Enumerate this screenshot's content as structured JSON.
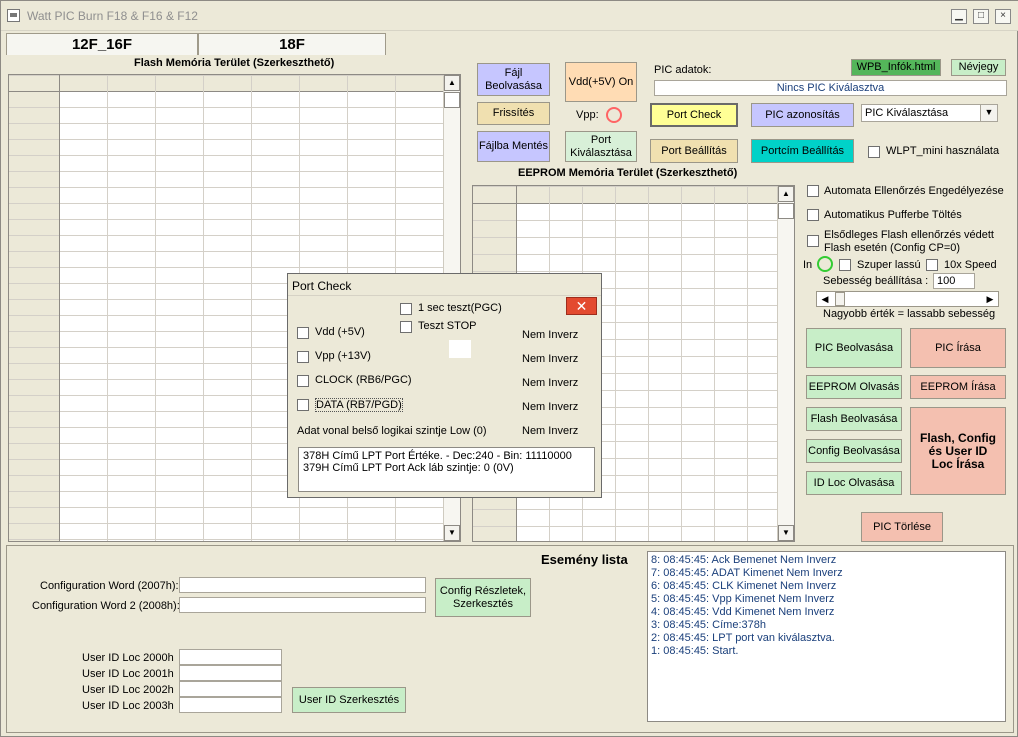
{
  "window": {
    "title": "Watt PIC Burn F18 & F16 & F12",
    "min_label": "▁",
    "max_label": "□",
    "close_label": "×"
  },
  "tabs": [
    "12F_16F",
    "18F"
  ],
  "flash": {
    "title": "Flash Memória Terület (Szerkeszthető)"
  },
  "eeprom": {
    "title": "EEPROM Memória Terület (Szerkeszthető)"
  },
  "buttons": {
    "file_read": "Fájl Beolvasása",
    "vdd_on": "Vdd(+5V) On",
    "refresh": "Frissítés",
    "file_save": "Fájlba Mentés",
    "port_select": "Port Kiválasztása",
    "port_check": "Port Check",
    "pic_identify": "PIC azonosítás",
    "port_settings": "Port Beállítás",
    "port_address_settings": "Portcím Beállítás",
    "wpb_info": "WPB_Infók.html",
    "business_card": "Névjegy",
    "pic_read": "PIC Beolvasása",
    "pic_write": "PIC  Írása",
    "eeprom_read": "EEPROM Olvasás",
    "eeprom_write": "EEPROM Írása",
    "flash_read": "Flash Beolvasása",
    "config_read": "Config Beolvasása",
    "idloc_read": "ID Loc Olvasása",
    "flash_config_write": "Flash, Config és User ID Loc Írása",
    "pic_erase": "PIC  Törlése",
    "config_details": "Config Részletek, Szerkesztés",
    "userid_edit": "User ID Szerkesztés"
  },
  "pic_info": {
    "label": "PIC adatok:",
    "value": "Nincs PIC Kiválasztva",
    "vpp_label": "Vpp:",
    "select_value": "PIC Kiválasztása",
    "wlpt_label": "WLPT_mini használata"
  },
  "options": {
    "auto_verify": "Automata Ellenőrzés Engedélyezése",
    "auto_buffer": "Automatikus Pufferbe Töltés",
    "priority_flash_1": "Elsődleges Flash ellenőrzés védett",
    "priority_flash_2": "Flash esetén (Config CP=0)",
    "in_label": "In",
    "super_slow": "Szuper lassú",
    "speed_10x": "10x Speed",
    "speed_label": "Sebesség beállítása :",
    "speed_value": "100",
    "speed_note": "Nagyobb érték = lassabb sebesség"
  },
  "config": {
    "word1_label": "Configuration Word (2007h):",
    "word2_label": "Configuration Word 2 (2008h):",
    "userid": [
      "User ID Loc 2000h",
      "User ID Loc 2001h",
      "User ID Loc 2002h",
      "User ID Loc 2003h"
    ]
  },
  "events": {
    "title": "Esemény lista",
    "items": [
      "8:  08:45:45:  Ack Bemenet Nem Inverz",
      "7:  08:45:45:  ADAT Kimenet Nem Inverz",
      "6:  08:45:45:  CLK Kimenet Nem Inverz",
      "5:  08:45:45:  Vpp Kimenet Nem Inverz",
      "4:  08:45:45:  Vdd Kimenet Nem Inverz",
      "3:  08:45:45:  Címe:378h",
      "2:  08:45:45:  LPT port van kiválasztva.",
      "1:  08:45:45:  Start."
    ]
  },
  "dialog": {
    "title": "Port Check",
    "close": "✕",
    "test_1sec": "1 sec teszt(PGC)",
    "test_stop": "Teszt STOP",
    "rows": [
      {
        "label": "Vdd (+5V)",
        "status": "Nem Inverz"
      },
      {
        "label": "Vpp (+13V)",
        "status": "Nem Inverz"
      },
      {
        "label": "CLOCK (RB6/PGC)",
        "status": "Nem Inverz"
      },
      {
        "label": "DATA (RB7/PGD)",
        "status": "Nem Inverz"
      }
    ],
    "data_line_label": "Adat vonal belső logikai szintje Low (0)",
    "data_line_status": "Nem Inverz",
    "output_lines": [
      "378H Című LPT Port Értéke. - Dec:240 - Bin: 11110000",
      "379H Című LPT Port Ack láb szintje: 0 (0V)"
    ]
  },
  "colors": {
    "file_button": "#c6c6ff",
    "vdd_button": "#ffdcb4",
    "refresh_button": "#f0e0b0",
    "port_check_button": "#ffff96",
    "identify_button": "#c6c6ff",
    "portcim_button": "#00d2c8",
    "green_button": "#c8eec8",
    "salmon_button": "#f4c0b0",
    "wpb_button": "#54b65a",
    "nevjegy_button": "#c8eec8"
  }
}
